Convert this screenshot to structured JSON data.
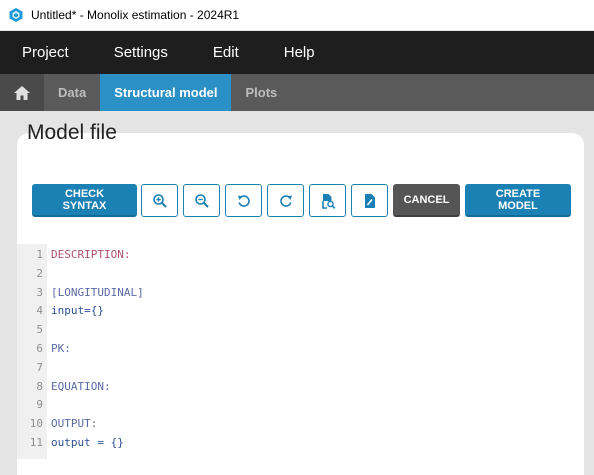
{
  "window": {
    "title": "Untitled* - Monolix estimation - 2024R1"
  },
  "menu": {
    "items": [
      "Project",
      "Settings",
      "Edit",
      "Help"
    ]
  },
  "tabs": {
    "items": [
      "Data",
      "Structural model",
      "Plots"
    ],
    "active": "Structural model"
  },
  "page": {
    "title": "Model file"
  },
  "toolbar": {
    "check_syntax": "CHECK SYNTAX",
    "cancel": "CANCEL",
    "create_model": "CREATE MODEL",
    "icons": [
      "zoom-in-icon",
      "zoom-out-icon",
      "undo-icon",
      "redo-icon",
      "search-file-icon",
      "edit-file-icon"
    ]
  },
  "editor": {
    "lines": [
      {
        "n": "1",
        "text": "DESCRIPTION:",
        "color": "#b0506a"
      },
      {
        "n": "2",
        "text": "",
        "color": "#000000"
      },
      {
        "n": "3",
        "text": "[LONGITUDINAL]",
        "color": "#5a6aa5"
      },
      {
        "n": "4",
        "text": "input={}",
        "color": "#2e4f95"
      },
      {
        "n": "5",
        "text": "",
        "color": "#000000"
      },
      {
        "n": "6",
        "text": "PK:",
        "color": "#5a6aa5"
      },
      {
        "n": "7",
        "text": "",
        "color": "#000000"
      },
      {
        "n": "8",
        "text": "EQUATION:",
        "color": "#5a6aa5"
      },
      {
        "n": "9",
        "text": "",
        "color": "#000000"
      },
      {
        "n": "10",
        "text": "OUTPUT:",
        "color": "#5a6aa5"
      },
      {
        "n": "11",
        "text": "output = {}",
        "color": "#2e4f95"
      }
    ]
  },
  "colors": {
    "accent": "#2a90c5",
    "button_blue": "#1b80b3",
    "menubar": "#1e1e1e",
    "tabbar": "#5a5a5a"
  }
}
